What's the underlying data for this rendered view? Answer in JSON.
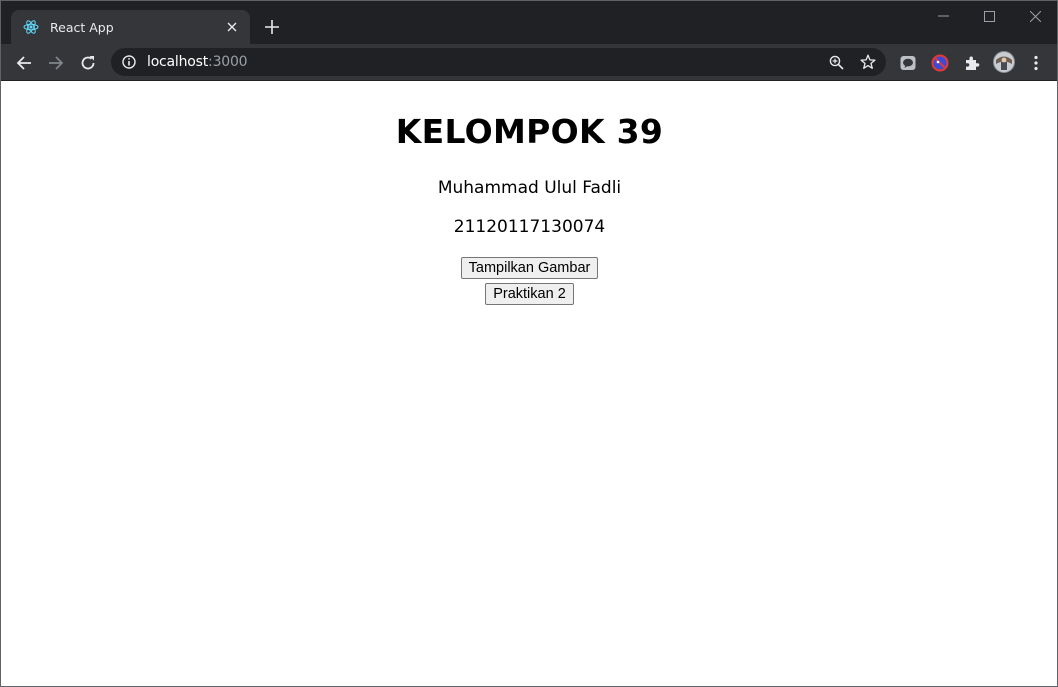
{
  "browser": {
    "tab": {
      "title": "React App"
    },
    "address_bar": {
      "host": "localhost",
      "port": ":3000"
    },
    "colors": {
      "chrome_dark": "#202124",
      "toolbar": "#35363a",
      "tab_text": "#e8eaed",
      "react_blue": "#61dafb"
    }
  },
  "icons": {
    "favicon": "react-logo-icon",
    "tab_close": "close-icon",
    "new_tab": "plus-icon",
    "back": "arrow-left-icon",
    "forward": "arrow-right-icon",
    "reload": "reload-icon",
    "site_info": "info-icon",
    "zoom": "zoom-icon",
    "bookmark": "star-icon",
    "extension_1": "chat-bubble-icon",
    "extension_2": "blocked-icon",
    "extensions": "puzzle-icon",
    "profile": "avatar-icon",
    "menu": "kebab-menu-icon"
  },
  "page": {
    "heading": "KELOMPOK 39",
    "name": "Muhammad Ulul Fadli",
    "nim": "21120117130074",
    "buttons": {
      "show_image": "Tampilkan Gambar",
      "practicum": "Praktikan 2"
    }
  }
}
